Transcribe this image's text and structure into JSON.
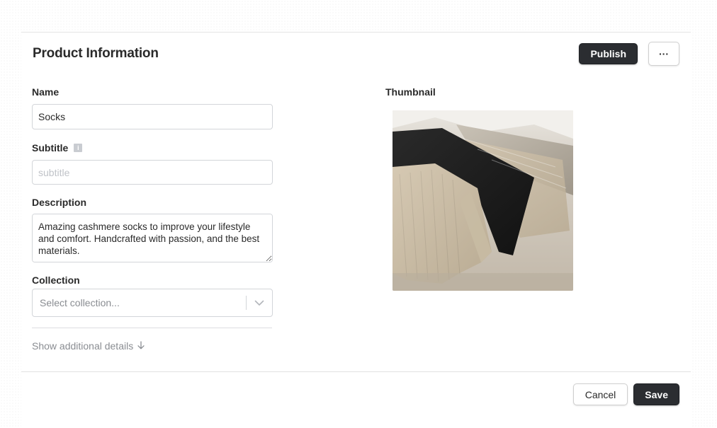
{
  "header": {
    "title": "Product Information",
    "publish_label": "Publish",
    "more_label": "···"
  },
  "form": {
    "name": {
      "label": "Name",
      "value": "Socks"
    },
    "subtitle": {
      "label": "Subtitle",
      "placeholder": "subtitle",
      "info_icon": "info-icon",
      "info_glyph": "i"
    },
    "description": {
      "label": "Description",
      "value": "Amazing cashmere socks to improve your lifestyle and comfort. Handcrafted with passion, and the best materials."
    },
    "collection": {
      "label": "Collection",
      "placeholder": "Select collection...",
      "chevron_icon": "chevron-down-icon"
    },
    "show_more": {
      "label": "Show additional details",
      "icon": "arrow-down-icon"
    }
  },
  "thumbnail": {
    "label": "Thumbnail",
    "image": "photo of folded cashmere socks in beige, black and grey"
  },
  "footer": {
    "cancel_label": "Cancel",
    "save_label": "Save"
  },
  "colors": {
    "dark_button": "#2b2d31",
    "border": "#d3d5d9",
    "muted_text": "#8a8d92"
  }
}
